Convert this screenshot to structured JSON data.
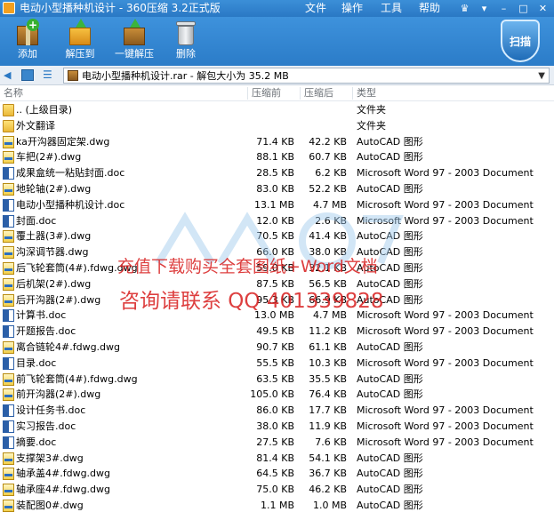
{
  "titlebar": {
    "title": "电动小型播种机设计 - 360压缩 3.2正式版",
    "menu": [
      "文件",
      "操作",
      "工具",
      "帮助"
    ]
  },
  "toolbar": {
    "add_label": "添加",
    "extract_label": "解压到",
    "oneclick_label": "一键解压",
    "delete_label": "删除",
    "scan_label": "扫描"
  },
  "address": {
    "path": "电动小型播种机设计.rar - 解包大小为 35.2 MB"
  },
  "columns": {
    "name": "名称",
    "packed": "压缩前",
    "size": "压缩后",
    "type": "类型"
  },
  "files": [
    {
      "icon": "folder",
      "name": ".. (上级目录)",
      "packed": "",
      "size": "",
      "type": "文件夹"
    },
    {
      "icon": "folder",
      "name": "外文翻译",
      "packed": "",
      "size": "",
      "type": "文件夹"
    },
    {
      "icon": "dwg",
      "name": "ka开沟器固定架.dwg",
      "packed": "71.4 KB",
      "size": "42.2 KB",
      "type": "AutoCAD 图形"
    },
    {
      "icon": "dwg",
      "name": "车把(2#).dwg",
      "packed": "88.1 KB",
      "size": "60.7 KB",
      "type": "AutoCAD 图形"
    },
    {
      "icon": "doc",
      "name": "成果盒统一粘贴封面.doc",
      "packed": "28.5 KB",
      "size": "6.2 KB",
      "type": "Microsoft Word 97 - 2003 Document"
    },
    {
      "icon": "dwg",
      "name": "地轮轴(2#).dwg",
      "packed": "83.0 KB",
      "size": "52.2 KB",
      "type": "AutoCAD 图形"
    },
    {
      "icon": "doc",
      "name": "电动小型播种机设计.doc",
      "packed": "13.1 MB",
      "size": "4.7 MB",
      "type": "Microsoft Word 97 - 2003 Document"
    },
    {
      "icon": "doc",
      "name": "封面.doc",
      "packed": "12.0 KB",
      "size": "2.6 KB",
      "type": "Microsoft Word 97 - 2003 Document"
    },
    {
      "icon": "dwg",
      "name": "覆土器(3#).dwg",
      "packed": "70.5 KB",
      "size": "41.4 KB",
      "type": "AutoCAD 图形"
    },
    {
      "icon": "dwg",
      "name": "沟深调节器.dwg",
      "packed": "66.0 KB",
      "size": "38.0 KB",
      "type": "AutoCAD 图形"
    },
    {
      "icon": "dwg",
      "name": "后飞轮套筒(4#).fdwg.dwg",
      "packed": "59.0 KB",
      "size": "32.1 KB",
      "type": "AutoCAD 图形"
    },
    {
      "icon": "dwg",
      "name": "后机架(2#).dwg",
      "packed": "87.5 KB",
      "size": "56.5 KB",
      "type": "AutoCAD 图形"
    },
    {
      "icon": "dwg",
      "name": "后开沟器(2#).dwg",
      "packed": "95.3 KB",
      "size": "66.9 KB",
      "type": "AutoCAD 图形"
    },
    {
      "icon": "doc",
      "name": "计算书.doc",
      "packed": "13.0 MB",
      "size": "4.7 MB",
      "type": "Microsoft Word 97 - 2003 Document"
    },
    {
      "icon": "doc",
      "name": "开题报告.doc",
      "packed": "49.5 KB",
      "size": "11.2 KB",
      "type": "Microsoft Word 97 - 2003 Document"
    },
    {
      "icon": "dwg",
      "name": "离合链轮4#.fdwg.dwg",
      "packed": "90.7 KB",
      "size": "61.1 KB",
      "type": "AutoCAD 图形"
    },
    {
      "icon": "doc",
      "name": "目录.doc",
      "packed": "55.5 KB",
      "size": "10.3 KB",
      "type": "Microsoft Word 97 - 2003 Document"
    },
    {
      "icon": "dwg",
      "name": "前飞轮套筒(4#).fdwg.dwg",
      "packed": "63.5 KB",
      "size": "35.5 KB",
      "type": "AutoCAD 图形"
    },
    {
      "icon": "dwg",
      "name": "前开沟器(2#).dwg",
      "packed": "105.0 KB",
      "size": "76.4 KB",
      "type": "AutoCAD 图形"
    },
    {
      "icon": "doc",
      "name": "设计任务书.doc",
      "packed": "86.0 KB",
      "size": "17.7 KB",
      "type": "Microsoft Word 97 - 2003 Document"
    },
    {
      "icon": "doc",
      "name": "实习报告.doc",
      "packed": "38.0 KB",
      "size": "11.9 KB",
      "type": "Microsoft Word 97 - 2003 Document"
    },
    {
      "icon": "doc",
      "name": "摘要.doc",
      "packed": "27.5 KB",
      "size": "7.6 KB",
      "type": "Microsoft Word 97 - 2003 Document"
    },
    {
      "icon": "dwg",
      "name": "支撑架3#.dwg",
      "packed": "81.4 KB",
      "size": "54.1 KB",
      "type": "AutoCAD 图形"
    },
    {
      "icon": "dwg",
      "name": "轴承盖4#.fdwg.dwg",
      "packed": "64.5 KB",
      "size": "36.7 KB",
      "type": "AutoCAD 图形"
    },
    {
      "icon": "dwg",
      "name": "轴承座4#.fdwg.dwg",
      "packed": "75.0 KB",
      "size": "46.2 KB",
      "type": "AutoCAD 图形"
    },
    {
      "icon": "dwg",
      "name": "装配图0#.dwg",
      "packed": "1.1 MB",
      "size": "1.0 MB",
      "type": "AutoCAD 图形"
    }
  ],
  "watermark": {
    "line1": "充值下载购买全套图纸+Word文档",
    "line2": "咨询请联系 QQ 401339828"
  }
}
